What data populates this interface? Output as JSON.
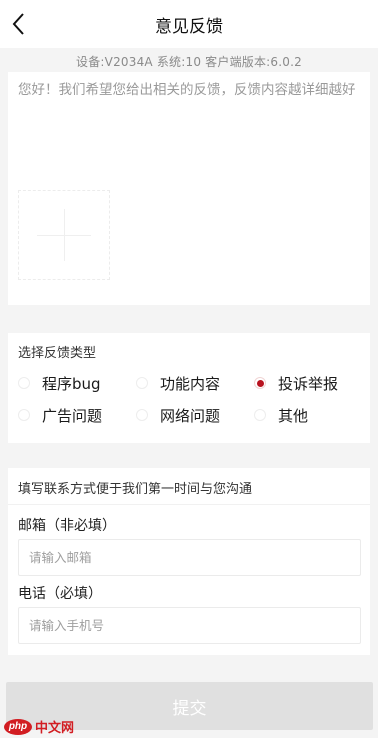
{
  "header": {
    "title": "意见反馈",
    "back_icon": "chevron-left-icon"
  },
  "device_info": "设备:V2034A    系统:10    客户端版本:6.0.2",
  "feedback": {
    "placeholder": "您好！我们希望您给出相关的反馈，反馈内容越详细越好",
    "value": "",
    "add_image_icon": "plus-icon"
  },
  "type_section": {
    "title": "选择反馈类型",
    "options": [
      {
        "label": "程序bug",
        "checked": false
      },
      {
        "label": "功能内容",
        "checked": false
      },
      {
        "label": "投诉举报",
        "checked": true
      },
      {
        "label": "广告问题",
        "checked": false
      },
      {
        "label": "网络问题",
        "checked": false
      },
      {
        "label": "其他",
        "checked": false
      }
    ],
    "selected_color": "#b8121f"
  },
  "contact_section": {
    "title": "填写联系方式便于我们第一时间与您沟通",
    "email_label": "邮箱（非必填）",
    "email_placeholder": "请输入邮箱",
    "email_value": "",
    "phone_label": "电话（必填）",
    "phone_placeholder": "请输入手机号",
    "phone_value": ""
  },
  "submit_label": "提交",
  "watermark": {
    "logo": "php",
    "text": "中文网",
    "color": "#d21d22"
  }
}
